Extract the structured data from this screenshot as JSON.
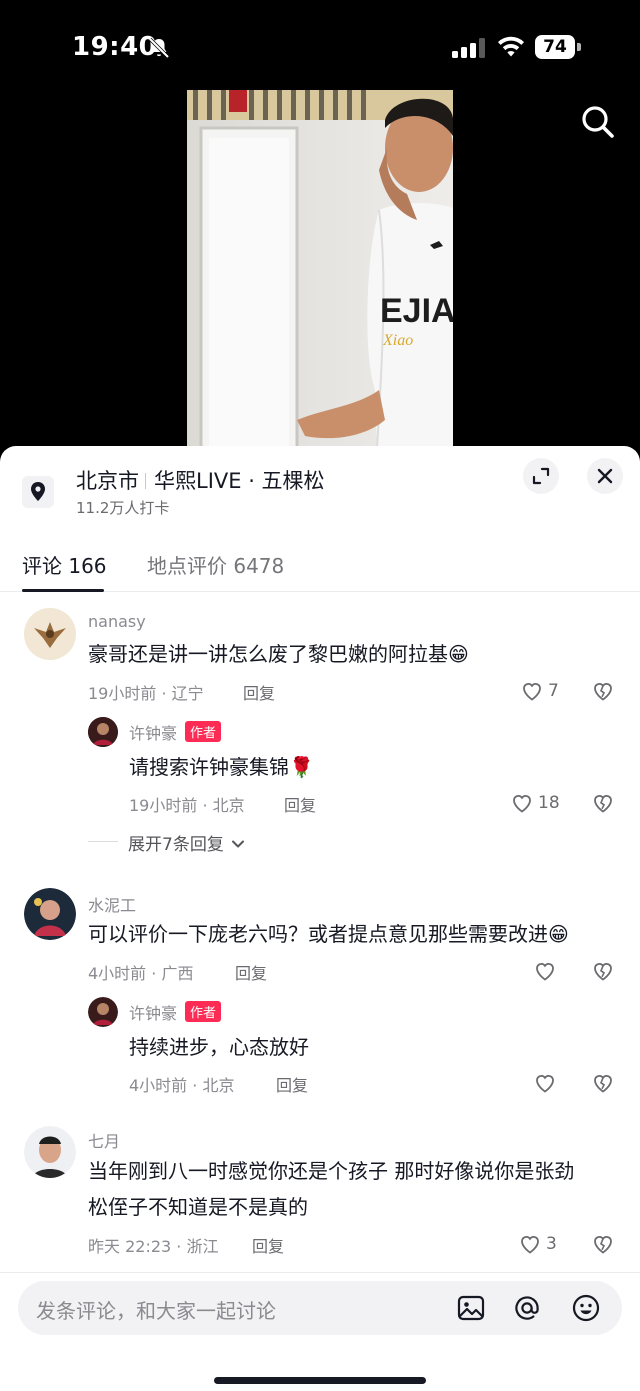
{
  "status_bar": {
    "time": "19:40",
    "battery": "74"
  },
  "location": {
    "city": "北京市",
    "venue": "华熙LIVE · 五棵松",
    "checkins": "11.2万人打卡"
  },
  "tabs": [
    {
      "label": "评论 166"
    },
    {
      "label": "地点评价 6478"
    }
  ],
  "comments": [
    {
      "user": "nanasy",
      "text": "豪哥还是讲一讲怎么废了黎巴嫩的阿拉基😁",
      "time_loc": "19小时前 · 辽宁",
      "reply": "回复",
      "likes": "7",
      "replies": [
        {
          "user": "许钟豪",
          "badge": "作者",
          "text": "请搜索许钟豪集锦🌹",
          "time_loc": "19小时前 · 北京",
          "reply": "回复",
          "likes": "18"
        }
      ],
      "expand": "展开7条回复"
    },
    {
      "user": "水泥工",
      "text": "可以评价一下庞老六吗？或者提点意见那些需要改进😁",
      "time_loc": "4小时前 · 广西",
      "reply": "回复",
      "likes": "",
      "replies": [
        {
          "user": "许钟豪",
          "badge": "作者",
          "text": "持续进步，心态放好",
          "time_loc": "4小时前 · 北京",
          "reply": "回复",
          "likes": ""
        }
      ]
    },
    {
      "user": "七月",
      "text_line1": "当年刚到八一时感觉你还是个孩子 那时好像说你是张劲",
      "text_line2": "松侄子不知道是不是真的",
      "time_loc": "昨天 22:23 · 浙江",
      "reply": "回复",
      "likes": "3"
    }
  ],
  "input": {
    "placeholder": "发条评论，和大家一起讨论"
  },
  "colors": {
    "accent": "#fe2c55",
    "text": "#161823",
    "muted": "#8a8a90"
  }
}
